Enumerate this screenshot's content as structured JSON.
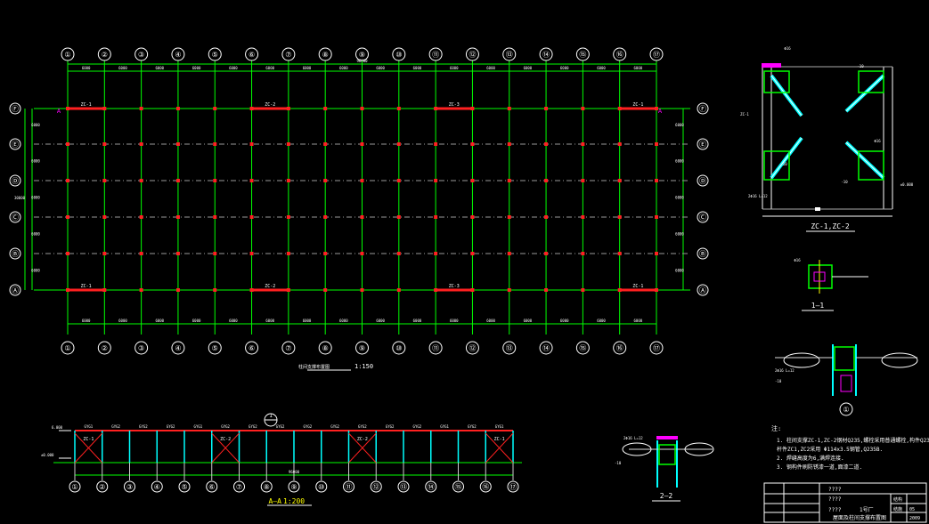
{
  "colors": {
    "background": "#000000",
    "grid_line": "#00ff00",
    "axis_bubble": "#ffffff",
    "column": "#ff2020",
    "brace": "#ff2020",
    "detail_steel": "#00ffff",
    "text": "#ffffff",
    "magenta": "#ff00ff",
    "yellow": "#ffff00"
  },
  "plan": {
    "title": "柱间支撑布置图",
    "scale": "1:150",
    "column_axes": [
      "①",
      "②",
      "③",
      "④",
      "⑤",
      "⑥",
      "⑦",
      "⑧",
      "⑨",
      "⑩",
      "⑪",
      "⑫",
      "⑬",
      "⑭",
      "⑮",
      "⑯",
      "⑰"
    ],
    "row_axes": [
      "Ⓕ",
      "Ⓔ",
      "Ⓓ",
      "Ⓒ",
      "Ⓑ",
      "Ⓐ"
    ],
    "bay_dim": "6000",
    "total_dim": "96000",
    "span_dim": "30000",
    "top_braces": [
      "ZC-1",
      "ZC-2",
      "ZC-3",
      "ZC-1"
    ],
    "bottom_braces": [
      "ZC-1",
      "ZC-2",
      "ZC-3",
      "ZC-1"
    ],
    "corner_marker": "A"
  },
  "elevation": {
    "title": "A—A",
    "scale": "1:200",
    "braces": [
      "ZC-1",
      "ZC-2",
      "ZC-2",
      "ZC-1"
    ],
    "segment_labels": [
      "GYG1",
      "GYG2",
      "GYG2",
      "GYG2",
      "GYG1",
      "GYG2",
      "GYG2",
      "GYG2",
      "GYG2",
      "GYG2",
      "GYG2",
      "GYG2",
      "GYG2",
      "GYG1",
      "GYG2",
      "GYG1"
    ],
    "elevation_top": "6.000",
    "elevation_mid": "±0.000",
    "total_dim": "96000",
    "section_mark": "1"
  },
  "details": {
    "zc_title": "ZC-1,ZC-2",
    "section_1_1": "1—1",
    "section_2_2": "2—2",
    "detail_1": "①",
    "elev_label": "±0.000",
    "zc_labels": [
      "Φ16",
      "-10",
      "-10",
      "ZC-1",
      "-10",
      "Φ16"
    ],
    "anchor_text": "2Φ16 L=12"
  },
  "notes": {
    "heading": "注:",
    "lines": [
      "1. 柱间支撑ZC-1,ZC-2钢材Q235,螺栓采用普通螺栓,构件Q235B.",
      "   杆件ZC1,ZC2采用 Φ114x3.5钢管,Q235B.",
      "2. 焊缝高度为6,满焊连接.",
      "3. 钢构件刷防锈漆一道,面漆二道."
    ]
  },
  "title_block": {
    "project": "????",
    "drawing": "????",
    "drawing_name": "屋面及柱间支撑布置图",
    "cell_a": "????",
    "cell_b": "1号厂",
    "cell_c": "结构",
    "cell_d": "结施",
    "cell_e": "05",
    "cell_f": "2009"
  }
}
